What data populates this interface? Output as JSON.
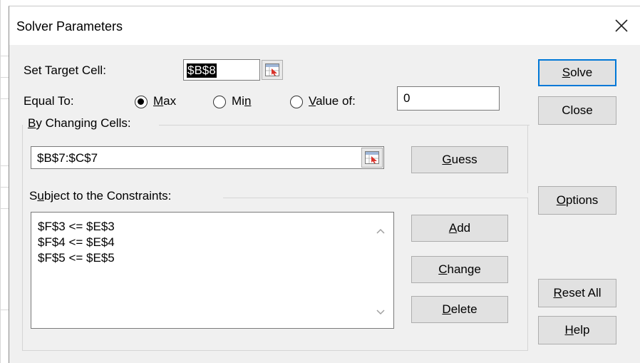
{
  "dialog": {
    "title": "Solver Parameters",
    "close_label": "close"
  },
  "target": {
    "label_pre": "Set Target Cell:",
    "value": "$B$8"
  },
  "equal_to": {
    "label": "Equal To:",
    "options": [
      {
        "pre": "",
        "accel": "M",
        "post": "ax",
        "selected": true
      },
      {
        "pre": "Mi",
        "accel": "n",
        "post": "",
        "selected": false
      },
      {
        "pre": "",
        "accel": "V",
        "post": "alue of:",
        "selected": false
      }
    ],
    "value_of": "0"
  },
  "changing": {
    "accel": "B",
    "label_rest": "y Changing Cells:",
    "value": "$B$7:$C$7",
    "guess_accel": "G",
    "guess_rest": "uess"
  },
  "constraints": {
    "label_pre": "S",
    "accel": "u",
    "label_rest": "bject to the Constraints:",
    "items": [
      "$F$3 <= $E$3",
      "$F$4 <= $E$4",
      "$F$5 <= $E$5"
    ]
  },
  "buttons": {
    "solve": {
      "accel": "S",
      "rest": "olve"
    },
    "close": "Close",
    "options": {
      "accel": "O",
      "rest": "ptions"
    },
    "add": {
      "accel": "A",
      "rest": "dd"
    },
    "change": {
      "accel": "C",
      "rest": "hange"
    },
    "delete": {
      "accel": "D",
      "rest": "elete"
    },
    "reset": {
      "accel": "R",
      "rest": "eset All"
    },
    "help": {
      "accel": "H",
      "rest": "elp"
    }
  }
}
